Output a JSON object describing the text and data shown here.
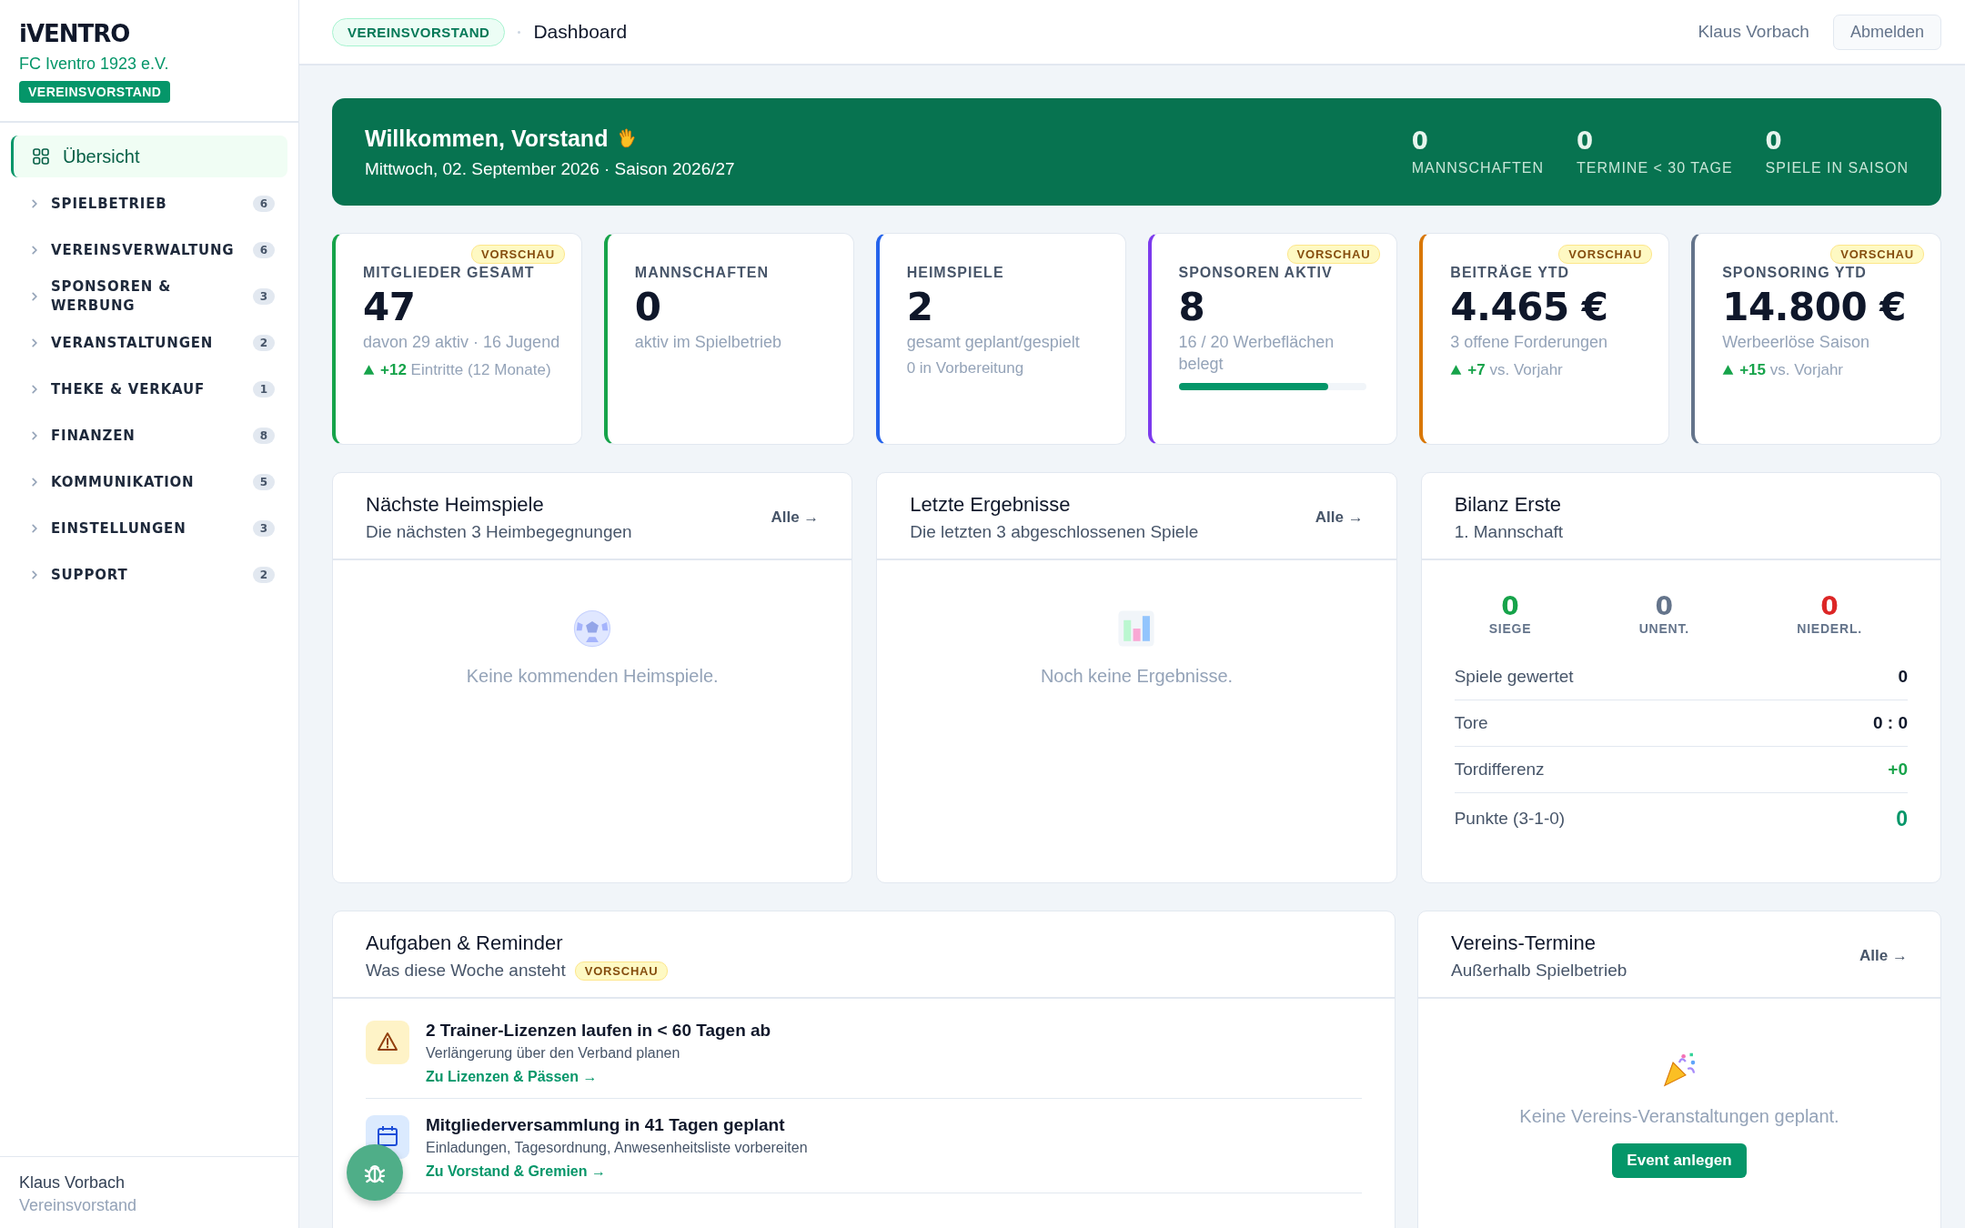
{
  "sidebar": {
    "logo": "iVENTRO",
    "club": "FC Iventro 1923 e.V.",
    "role_badge": "VEREINSVORSTAND",
    "items": [
      {
        "kind": "link",
        "label": "Übersicht",
        "selected": true
      },
      {
        "kind": "group",
        "label": "SPIELBETRIEB",
        "count": "6",
        "expanded": false,
        "selected": false
      },
      {
        "kind": "group",
        "label": "VEREINSVERWALTUNG",
        "count": "6",
        "expanded": false,
        "selected": false
      },
      {
        "kind": "group",
        "label": "SPONSOREN & WERBUNG",
        "count": "3",
        "expanded": false,
        "selected": false
      },
      {
        "kind": "group",
        "label": "VERANSTALTUNGEN",
        "count": "2",
        "expanded": false,
        "selected": false
      },
      {
        "kind": "group",
        "label": "THEKE & VERKAUF",
        "count": "1",
        "expanded": false,
        "selected": false
      },
      {
        "kind": "group",
        "label": "FINANZEN",
        "count": "8",
        "expanded": false,
        "selected": false
      },
      {
        "kind": "group",
        "label": "KOMMUNIKATION",
        "count": "5",
        "expanded": false,
        "selected": false
      },
      {
        "kind": "group",
        "label": "EINSTELLUNGEN",
        "count": "3",
        "expanded": false,
        "selected": false
      },
      {
        "kind": "group",
        "label": "SUPPORT",
        "count": "2",
        "expanded": false,
        "selected": false
      }
    ],
    "user": {
      "name": "Klaus Vorbach",
      "role": "Vereinsvorstand"
    }
  },
  "topbar": {
    "role_pill": "VEREINSVORSTAND",
    "page_title": "Dashboard",
    "user_name": "Klaus Vorbach",
    "logout": "Abmelden"
  },
  "banner": {
    "title": "Willkommen, Vorstand",
    "subtitle": "Mittwoch, 02. September 2026 · Saison 2026/27",
    "stats": [
      {
        "value": "0",
        "label": "MANNSCHAFTEN"
      },
      {
        "value": "0",
        "label": "TERMINE < 30 TAGE"
      },
      {
        "value": "0",
        "label": "SPIELE IN SAISON"
      }
    ]
  },
  "stat_cards": [
    {
      "title": "MITGLIEDER GESAMT",
      "value": "47",
      "color": "#16a34a",
      "badge": "VORSCHAU",
      "lines": [
        "davon 29 aktiv · 16 Jugend"
      ],
      "trend": {
        "delta": "+12",
        "text": "Eintritte (12 Monate)"
      }
    },
    {
      "title": "MANNSCHAFTEN",
      "value": "0",
      "color": "#16a34a",
      "lines": [
        "aktiv im Spielbetrieb"
      ]
    },
    {
      "title": "HEIMSPIELE",
      "value": "2",
      "color": "#2563eb",
      "lines": [
        "gesamt geplant/gespielt",
        "0 in Vorbereitung"
      ]
    },
    {
      "title": "SPONSOREN AKTIV",
      "value": "8",
      "color": "#7c3aed",
      "badge": "VORSCHAU",
      "lines": [
        "16 / 20 Werbeflächen belegt"
      ],
      "level": 0.8
    },
    {
      "title": "BEITRÄGE YTD",
      "value": "4.465 €",
      "color": "#d97706",
      "badge": "VORSCHAU",
      "lines": [
        "3 offene Forderungen"
      ],
      "trend": {
        "delta": "+7",
        "text": "vs. Vorjahr"
      }
    },
    {
      "title": "SPONSORING YTD",
      "value": "14.800 €",
      "color": "#64748b",
      "badge": "VORSCHAU",
      "lines": [
        "Werbeerlöse Saison"
      ],
      "trend": {
        "delta": "+15",
        "text": "vs. Vorjahr"
      }
    }
  ],
  "panels": [
    {
      "kind": "fixtures",
      "title": "Nächste Heimspiele",
      "subtitle": "Die nächsten 3 Heimbegegnungen",
      "link": "Alle →",
      "empty_text": "Keine kommenden Heimspiele."
    },
    {
      "kind": "results",
      "title": "Letzte Ergebnisse",
      "subtitle": "Die letzten 3 abgeschlossenen Spiele",
      "link": "Alle →",
      "empty_text": "Noch keine Ergebnisse."
    },
    {
      "kind": "balance",
      "title": "Bilanz Erste",
      "subtitle": "1. Mannschaft",
      "totals": [
        {
          "value": "0",
          "label": "SIEGE",
          "color": "#16a34a"
        },
        {
          "value": "0",
          "label": "UNENT.",
          "color": "#64748b"
        },
        {
          "value": "0",
          "label": "NIEDERL.",
          "color": "#dc2626"
        }
      ],
      "rows": [
        {
          "label": "Spiele gewertet",
          "value": "0",
          "kind": "plain"
        },
        {
          "label": "Tore",
          "value": "0 : 0",
          "kind": "plain"
        },
        {
          "label": "Tordifferenz",
          "value": "+0",
          "kind": "positive"
        },
        {
          "label": "Punkte (3-1-0)",
          "value": "0",
          "kind": "total"
        }
      ]
    }
  ],
  "tasks": {
    "title": "Aufgaben & Reminder",
    "subtitle": "Was diese Woche ansteht",
    "badge": "VORSCHAU",
    "items": [
      {
        "kind": "warning",
        "title": "2 Trainer-Lizenzen laufen in < 60 Tagen ab",
        "text": "Verlängerung über den Verband planen",
        "link": "Zu Lizenzen & Pässen →"
      },
      {
        "kind": "calendar",
        "title": "Mitgliederversammlung in 41 Tagen geplant",
        "text": "Einladungen, Tagesordnung, Anwesenheitsliste vorbereiten",
        "link": "Zu Vorstand & Gremien →"
      }
    ]
  },
  "events": {
    "title": "Vereins-Termine",
    "subtitle": "Außerhalb Spielbetrieb",
    "link": "Alle →",
    "empty_text": "Keine Vereins-Veranstaltungen geplant.",
    "button": "Event anlegen"
  }
}
